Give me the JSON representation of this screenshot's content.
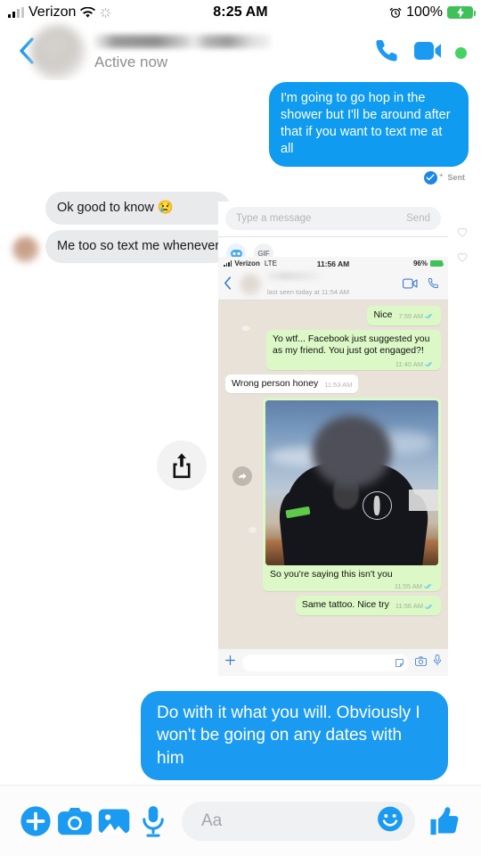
{
  "status_bar": {
    "carrier": "Verizon",
    "time": "8:25 AM",
    "battery_percent": "100%",
    "icons": [
      "signal-bars-icon",
      "wifi-icon",
      "spinner-icon",
      "alarm-icon",
      "battery-charging-icon"
    ]
  },
  "thread_header": {
    "contact_name": "",
    "status": "Active now",
    "actions": [
      "call-icon",
      "video-call-icon"
    ],
    "online": true
  },
  "messages": [
    {
      "id": "m1",
      "direction": "outgoing",
      "text": "I'm going to go hop in the shower but I'll be around after that if you want to text me at all"
    },
    {
      "id": "m2",
      "direction": "status",
      "text": "Sent"
    },
    {
      "id": "m3",
      "direction": "incoming",
      "text": "Ok good to know 😢"
    },
    {
      "id": "m4",
      "direction": "incoming",
      "text": "Me too so text me whenever"
    }
  ],
  "nested_messenger_preview": {
    "input_placeholder": "Type a message",
    "send_label": "Send",
    "chips": [
      {
        "name": "sticker-chip",
        "label": ""
      },
      {
        "name": "gif-chip",
        "label": "GIF"
      }
    ]
  },
  "whatsapp_screenshot": {
    "status_bar": {
      "carrier": "Verizon",
      "network": "LTE",
      "time": "11:56 AM",
      "battery_percent": "96%"
    },
    "header": {
      "contact_name": "",
      "subtitle": "last seen today at 11:54 AM",
      "actions": [
        "video-call-icon",
        "call-icon"
      ]
    },
    "messages": [
      {
        "id": "w1",
        "direction": "outgoing",
        "text": "Nice",
        "time": "7:59 AM",
        "ticks": "read"
      },
      {
        "id": "w2",
        "direction": "outgoing",
        "text": "Yo wtf... Facebook just suggested you as my friend. You just got engaged?!",
        "time": "11:40 AM",
        "ticks": "read"
      },
      {
        "id": "w3",
        "direction": "incoming",
        "text": "Wrong person honey",
        "time": "11:53 AM",
        "ticks": "none"
      },
      {
        "id": "w4",
        "direction": "outgoing",
        "type": "photo",
        "caption": "So you're saying this isn't you",
        "time": "11:55 AM",
        "ticks": "read"
      },
      {
        "id": "w5",
        "direction": "outgoing",
        "text": "Same tattoo. Nice try",
        "time": "11:56 AM",
        "ticks": "read"
      }
    ],
    "input_bar": {
      "placeholder": "",
      "icons": [
        "plus-icon",
        "sticker-icon",
        "camera-icon",
        "microphone-icon"
      ]
    },
    "forward_badge": "forward-icon"
  },
  "share_overlay": {
    "icon": "share-icon"
  },
  "final_message": {
    "direction": "outgoing",
    "text": "Do with it what you will. Obviously I won't be going on any dates with him"
  },
  "composer": {
    "placeholder": "Aa",
    "left_icons": [
      "add-plus-icon",
      "camera-icon",
      "photo-gallery-icon",
      "microphone-icon"
    ],
    "emoji_icon": "smiley-icon",
    "thumb_icon": "thumbs-up-icon"
  },
  "colors": {
    "messenger_blue": "#0e9bf0",
    "accent_blue": "#1a9af0",
    "incoming_gray": "#e9eaec",
    "whatsapp_green": "#dcf8c6",
    "whatsapp_bg": "#ece5dd",
    "online_green": "#44d362",
    "battery_green": "#3fc15a"
  }
}
